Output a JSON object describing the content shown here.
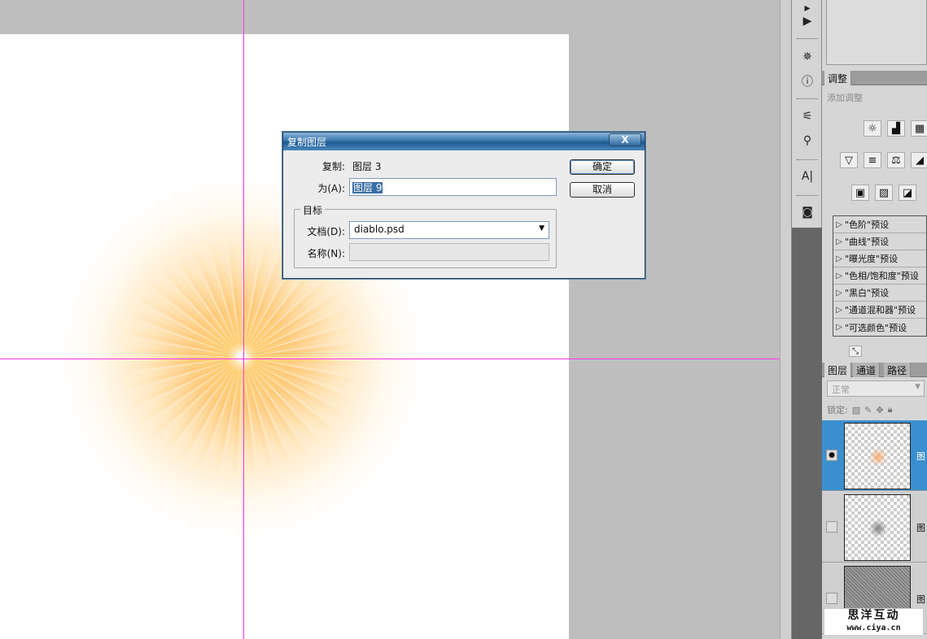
{
  "dialog": {
    "title": "复制图层",
    "close_label": "X",
    "duplicate_label": "复制:",
    "duplicate_value": "图层 3",
    "as_label": "为(A):",
    "as_value": "图层 9",
    "destination_group": "目标",
    "document_label": "文档(D):",
    "document_value": "diablo.psd",
    "name_label": "名称(N):",
    "name_value": "",
    "ok_label": "确定",
    "cancel_label": "取消"
  },
  "adjustments": {
    "tab": "调整",
    "subtitle": "添加调整",
    "presets": [
      "\"色阶\"预设",
      "\"曲线\"预设",
      "\"曝光度\"预设",
      "\"色相/饱和度\"预设",
      "\"黑白\"预设",
      "\"通道混和器\"预设",
      "\"可选颜色\"预设"
    ]
  },
  "layers": {
    "tabs": [
      "图层",
      "通道",
      "路径"
    ],
    "blend_mode": "正常",
    "lock_label": "锁定:",
    "items": [
      {
        "name": "图",
        "visible": true,
        "selected": true
      },
      {
        "name": "图",
        "visible": false,
        "selected": false
      },
      {
        "name": "图",
        "visible": false,
        "selected": false
      }
    ]
  },
  "watermark": {
    "name": "思洋互动",
    "url": "www.ciya.cn"
  },
  "colors": {
    "guide": "#ff33ee",
    "selection": "#3a8fd0",
    "titlebar": "#1d5b93"
  }
}
